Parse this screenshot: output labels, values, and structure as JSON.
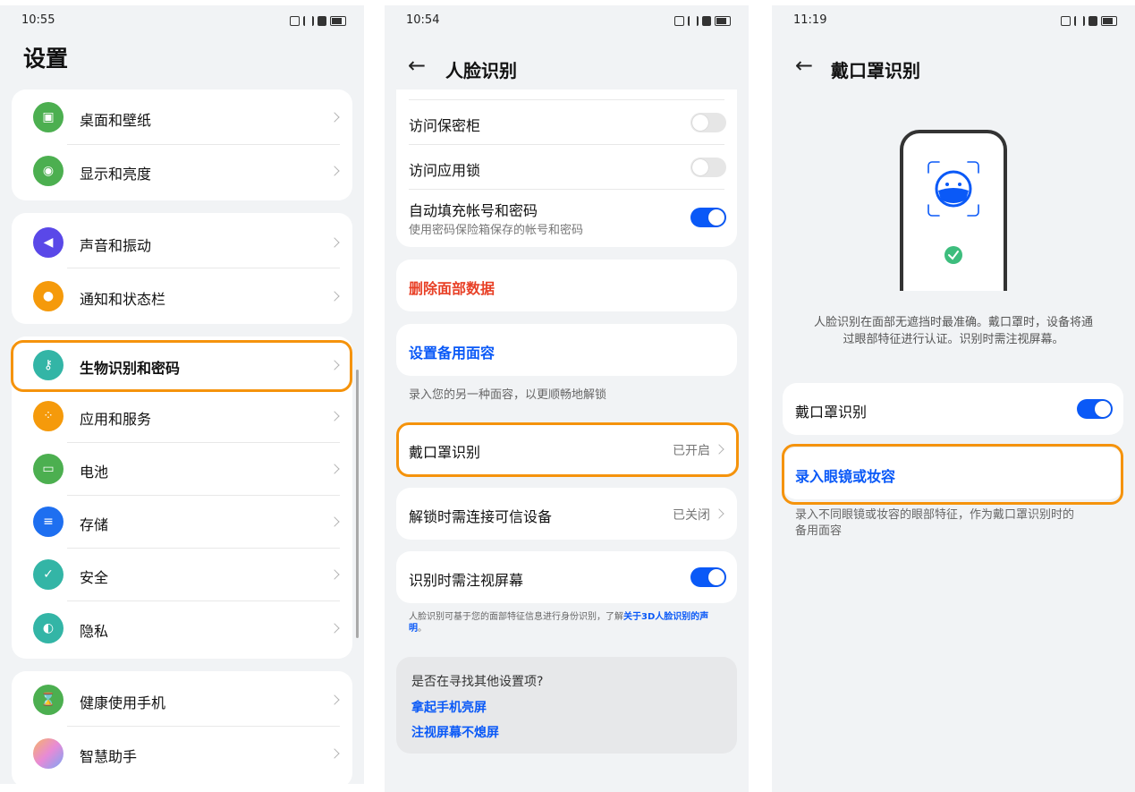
{
  "screen1": {
    "time": "10:55",
    "title": "设置",
    "groups": [
      {
        "items": [
          {
            "label": "桌面和壁纸",
            "icon": "image-icon",
            "color": "#4caf50"
          },
          {
            "label": "显示和亮度",
            "icon": "eye-icon",
            "color": "#4caf50"
          }
        ]
      },
      {
        "items": [
          {
            "label": "声音和振动",
            "icon": "speaker-icon",
            "color": "#5a48e8"
          },
          {
            "label": "通知和状态栏",
            "icon": "bell-icon",
            "color": "#f59a0b"
          }
        ]
      },
      {
        "items": [
          {
            "label": "生物识别和密码",
            "icon": "key-icon",
            "color": "#33b5a6"
          },
          {
            "label": "应用和服务",
            "icon": "apps-icon",
            "color": "#f59a0b"
          },
          {
            "label": "电池",
            "icon": "battery-icon",
            "color": "#4caf50"
          },
          {
            "label": "存储",
            "icon": "storage-icon",
            "color": "#1e6ff0"
          },
          {
            "label": "安全",
            "icon": "shield-icon",
            "color": "#33b5a6"
          },
          {
            "label": "隐私",
            "icon": "privacy-icon",
            "color": "#33b5a6"
          }
        ]
      },
      {
        "items": [
          {
            "label": "健康使用手机",
            "icon": "hourglass-icon",
            "color": "#4caf50"
          },
          {
            "label": "智慧助手",
            "icon": "assistant-icon",
            "color": "#e78ad6"
          }
        ]
      }
    ]
  },
  "screen2": {
    "time": "10:54",
    "title": "人脸识别",
    "vault_label": "访问保密柜",
    "applock_label": "访问应用锁",
    "autofill_label": "自动填充帐号和密码",
    "autofill_sub": "使用密码保险箱保存的帐号和密码",
    "delete_label": "删除面部数据",
    "backup_label": "设置备用面容",
    "backup_note": "录入您的另一种面容，以更顺畅地解锁",
    "mask_label": "戴口罩识别",
    "mask_value": "已开启",
    "trusted_label": "解锁时需连接可信设备",
    "trusted_value": "已关闭",
    "gaze_label": "识别时需注视屏幕",
    "hint_text": "人脸识别可基于您的面部特征信息进行身份识别，了解",
    "hint_link": "关于3D人脸识别的声明",
    "hint_end": "。",
    "more_title": "是否在寻找其他设置项?",
    "more_link1": "拿起手机亮屏",
    "more_link2": "注视屏幕不熄屏"
  },
  "screen3": {
    "time": "11:19",
    "title": "戴口罩识别",
    "desc_line1": "人脸识别在面部无遮挡时最准确。戴口罩时，设备将通",
    "desc_line2": "过眼部特征进行认证。识别时需注视屏幕。",
    "mask_toggle_label": "戴口罩识别",
    "enroll_label": "录入眼镜或妆容",
    "note_line1": "录入不同眼镜或妆容的眼部特征，作为戴口罩识别时的",
    "note_line2": "备用面容"
  },
  "colors": {
    "accent": "#0a59f7",
    "highlight": "#f5930c",
    "danger": "#e84026"
  }
}
